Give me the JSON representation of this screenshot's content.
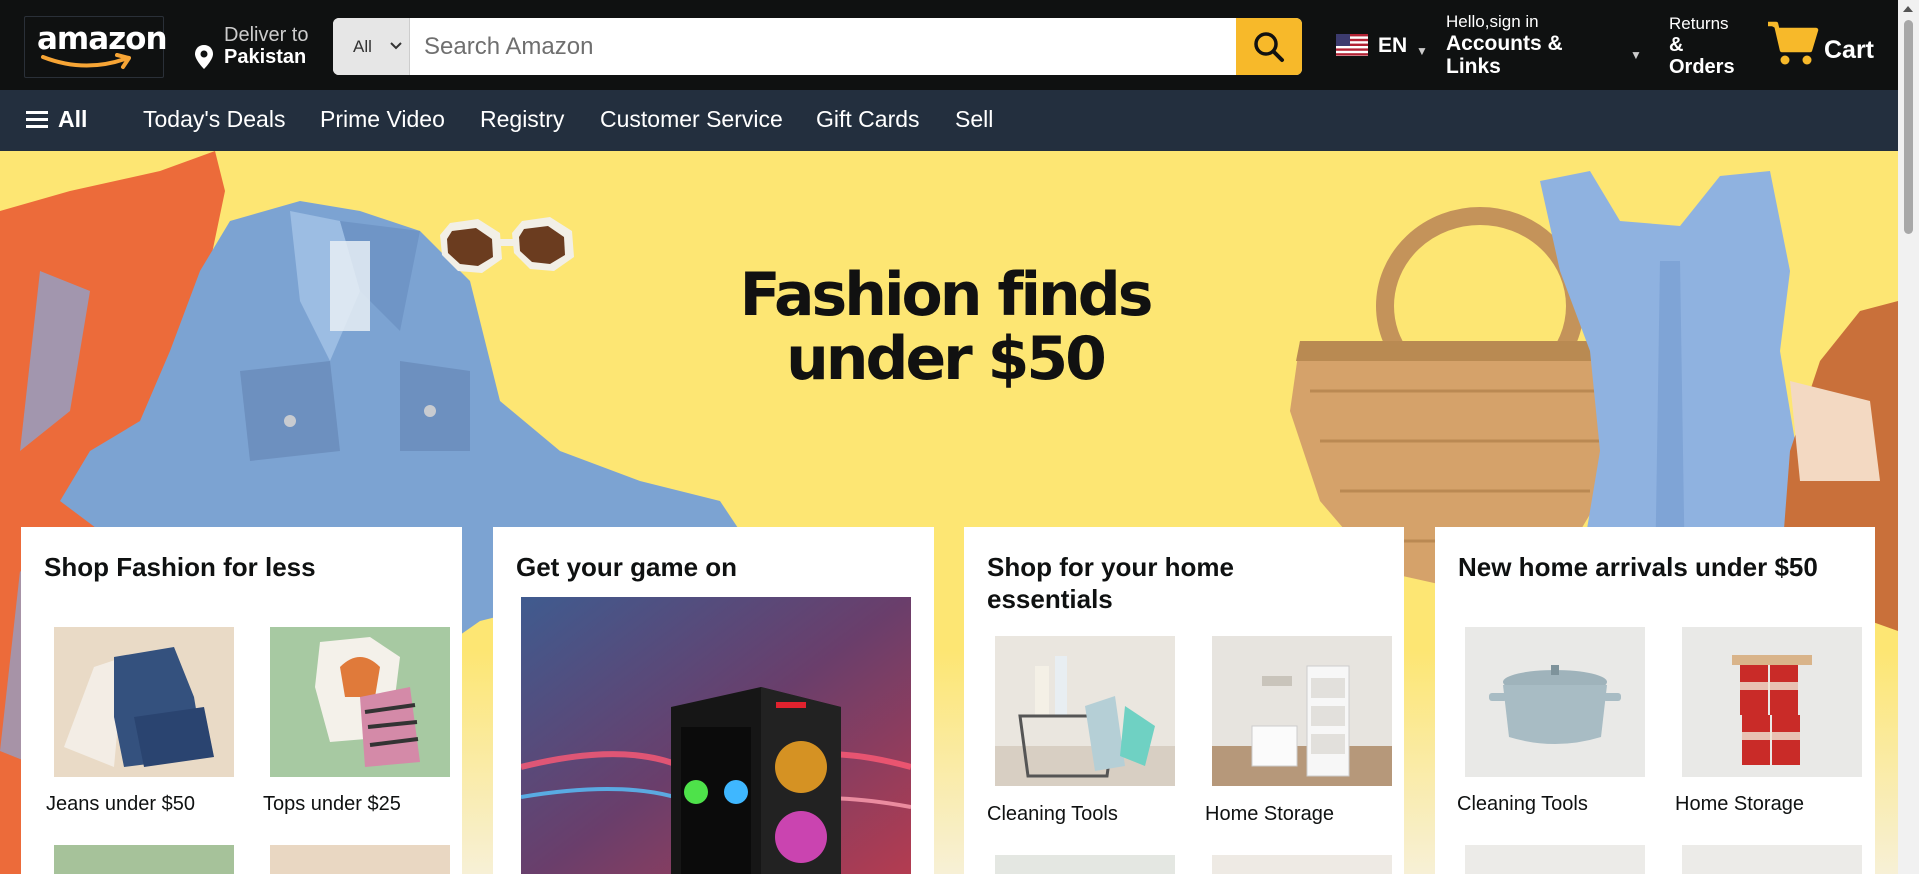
{
  "header": {
    "logo_text": "amazon",
    "deliver_line1": "Deliver to",
    "deliver_line2": "Pakistan",
    "search_category": "All",
    "search_placeholder": "Search Amazon",
    "language": "EN",
    "account_line1": "Hello,sign in",
    "account_line2": "Accounts & Links",
    "returns_line1": "Returns",
    "returns_line2": "& Orders",
    "cart_label": "Cart",
    "brand_color": "#f7b92a"
  },
  "nav": {
    "all_label": "All",
    "items": [
      "Today's Deals",
      "Prime Video",
      "Registry",
      "Customer Service",
      "Gift Cards",
      "Sell"
    ]
  },
  "hero": {
    "title": "Fashion finds under $50"
  },
  "cards": [
    {
      "title": "Shop Fashion for less",
      "tiles": [
        {
          "caption": "Jeans under $50",
          "icon": "jeans-image"
        },
        {
          "caption": "Tops under $25",
          "icon": "tops-image"
        }
      ]
    },
    {
      "title": "Get your game on",
      "tiles": [
        {
          "caption": "",
          "icon": "gaming-pc-image"
        }
      ]
    },
    {
      "title": "Shop for your home essentials",
      "tiles": [
        {
          "caption": "Cleaning Tools",
          "icon": "cleaning-tools-image"
        },
        {
          "caption": "Home Storage",
          "icon": "home-storage-image"
        }
      ]
    },
    {
      "title": "New home arrivals under $50",
      "tiles": [
        {
          "caption": "Cleaning Tools",
          "icon": "pot-image"
        },
        {
          "caption": "Home Storage",
          "icon": "canisters-image"
        }
      ]
    }
  ]
}
